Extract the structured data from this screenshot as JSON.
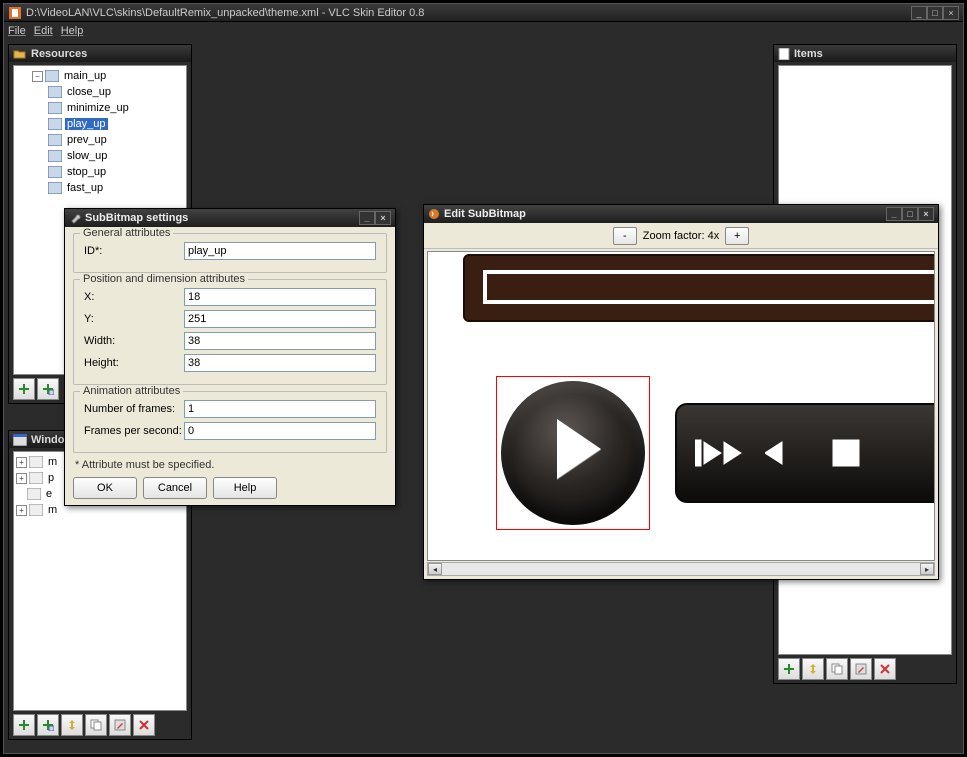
{
  "window": {
    "title": "D:\\VideoLAN\\VLC\\skins\\DefaultRemix_unpacked\\theme.xml - VLC Skin Editor 0.8"
  },
  "menu": {
    "file": "File",
    "edit": "Edit",
    "help": "Help"
  },
  "resources": {
    "title": "Resources",
    "root": "main_up",
    "items": [
      "close_up",
      "minimize_up",
      "play_up",
      "prev_up",
      "slow_up",
      "stop_up",
      "fast_up"
    ],
    "selected": 2
  },
  "windows_panel": {
    "title": "Windows",
    "items": [
      "m",
      "p",
      "e",
      "m"
    ]
  },
  "items_panel": {
    "title": "Items"
  },
  "subbitmap_dialog": {
    "title": "SubBitmap settings",
    "group_general": "General attributes",
    "id_label": "ID*:",
    "id_value": "play_up",
    "group_pos": "Position and dimension attributes",
    "x_label": "X:",
    "x_value": "18",
    "y_label": "Y:",
    "y_value": "251",
    "w_label": "Width:",
    "w_value": "38",
    "h_label": "Height:",
    "h_value": "38",
    "group_anim": "Animation attributes",
    "nframes_label": "Number of frames:",
    "nframes_value": "1",
    "fps_label": "Frames per second:",
    "fps_value": "0",
    "note": "* Attribute must be specified.",
    "ok": "OK",
    "cancel": "Cancel",
    "help": "Help"
  },
  "edit_subbitmap": {
    "title": "Edit SubBitmap",
    "zoom_label": "Zoom factor: 4x",
    "minus": "-",
    "plus": "+"
  }
}
